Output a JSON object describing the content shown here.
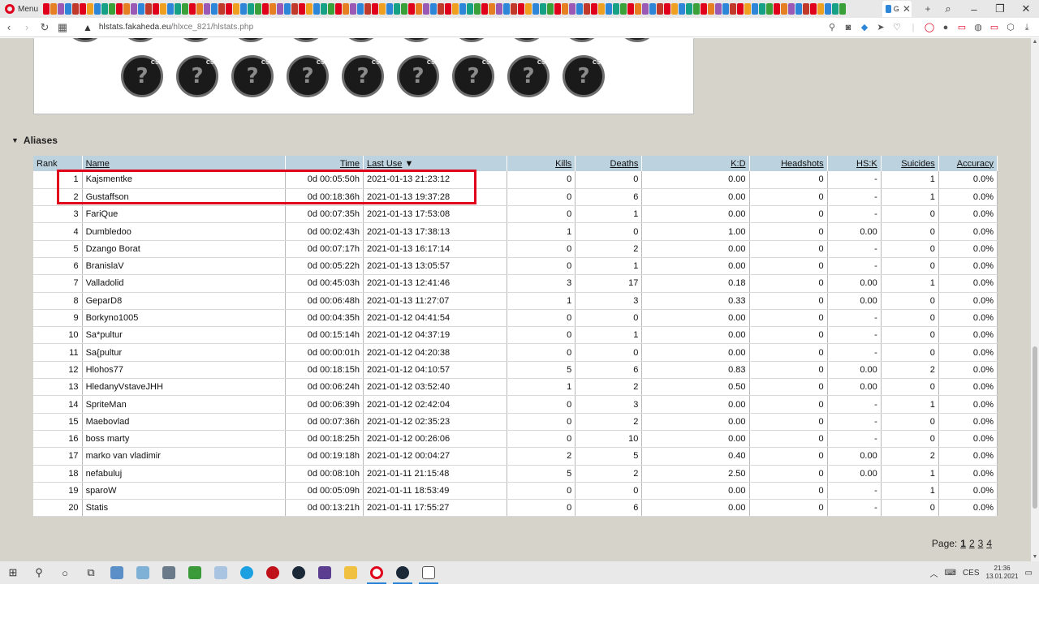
{
  "browser": {
    "menu_label": "Menu",
    "url_host": "hlstats.fakaheda.eu",
    "url_path": "/hlxce_821/hlstats.php",
    "active_tab_label": "G"
  },
  "aliases": {
    "section_title": "Aliases",
    "columns": [
      "Rank",
      "Name",
      "Time",
      "Last Use",
      "Kills",
      "Deaths",
      "K:D",
      "Headshots",
      "HS:K",
      "Suicides",
      "Accuracy"
    ],
    "sort_indicator": "▼",
    "rows": [
      [
        "1",
        "Kajsmentke",
        "0d 00:05:50h",
        "2021-01-13 21:23:12",
        "0",
        "0",
        "0.00",
        "0",
        "-",
        "1",
        "0.0%"
      ],
      [
        "2",
        "Gustaffson",
        "0d 00:18:36h",
        "2021-01-13 19:37:28",
        "0",
        "6",
        "0.00",
        "0",
        "-",
        "1",
        "0.0%"
      ],
      [
        "3",
        "FariQue",
        "0d 00:07:35h",
        "2021-01-13 17:53:08",
        "0",
        "1",
        "0.00",
        "0",
        "-",
        "0",
        "0.0%"
      ],
      [
        "4",
        "Dumbledoo",
        "0d 00:02:43h",
        "2021-01-13 17:38:13",
        "1",
        "0",
        "1.00",
        "0",
        "0.00",
        "0",
        "0.0%"
      ],
      [
        "5",
        "Dzango Borat",
        "0d 00:07:17h",
        "2021-01-13 16:17:14",
        "0",
        "2",
        "0.00",
        "0",
        "-",
        "0",
        "0.0%"
      ],
      [
        "6",
        "BranislaV",
        "0d 00:05:22h",
        "2021-01-13 13:05:57",
        "0",
        "1",
        "0.00",
        "0",
        "-",
        "0",
        "0.0%"
      ],
      [
        "7",
        "Valladolid",
        "0d 00:45:03h",
        "2021-01-13 12:41:46",
        "3",
        "17",
        "0.18",
        "0",
        "0.00",
        "1",
        "0.0%"
      ],
      [
        "8",
        "GeparD8",
        "0d 00:06:48h",
        "2021-01-13 11:27:07",
        "1",
        "3",
        "0.33",
        "0",
        "0.00",
        "0",
        "0.0%"
      ],
      [
        "9",
        "Borkyno1005",
        "0d 00:04:35h",
        "2021-01-12 04:41:54",
        "0",
        "0",
        "0.00",
        "0",
        "-",
        "0",
        "0.0%"
      ],
      [
        "10",
        "Sa*pultur",
        "0d 00:15:14h",
        "2021-01-12 04:37:19",
        "0",
        "1",
        "0.00",
        "0",
        "-",
        "0",
        "0.0%"
      ],
      [
        "11",
        "Sa{pultur",
        "0d 00:00:01h",
        "2021-01-12 04:20:38",
        "0",
        "0",
        "0.00",
        "0",
        "-",
        "0",
        "0.0%"
      ],
      [
        "12",
        "Hlohos77",
        "0d 00:18:15h",
        "2021-01-12 04:10:57",
        "5",
        "6",
        "0.83",
        "0",
        "0.00",
        "2",
        "0.0%"
      ],
      [
        "13",
        "HledanyVstaveJHH",
        "0d 00:06:24h",
        "2021-01-12 03:52:40",
        "1",
        "2",
        "0.50",
        "0",
        "0.00",
        "0",
        "0.0%"
      ],
      [
        "14",
        "SpriteMan",
        "0d 00:06:39h",
        "2021-01-12 02:42:04",
        "0",
        "3",
        "0.00",
        "0",
        "-",
        "1",
        "0.0%"
      ],
      [
        "15",
        "Maebovlad",
        "0d 00:07:36h",
        "2021-01-12 02:35:23",
        "0",
        "2",
        "0.00",
        "0",
        "-",
        "0",
        "0.0%"
      ],
      [
        "16",
        "boss marty",
        "0d 00:18:25h",
        "2021-01-12 00:26:06",
        "0",
        "10",
        "0.00",
        "0",
        "-",
        "0",
        "0.0%"
      ],
      [
        "17",
        "marko van vladimir",
        "0d 00:19:18h",
        "2021-01-12 00:04:27",
        "2",
        "5",
        "0.40",
        "0",
        "0.00",
        "2",
        "0.0%"
      ],
      [
        "18",
        "nefabuluj",
        "0d 00:08:10h",
        "2021-01-11 21:15:48",
        "5",
        "2",
        "2.50",
        "0",
        "0.00",
        "1",
        "0.0%"
      ],
      [
        "19",
        "sparoW",
        "0d 00:05:09h",
        "2021-01-11 18:53:49",
        "0",
        "0",
        "0.00",
        "0",
        "-",
        "1",
        "0.0%"
      ],
      [
        "20",
        "Statis",
        "0d 00:13:21h",
        "2021-01-11 17:55:27",
        "0",
        "6",
        "0.00",
        "0",
        "-",
        "0",
        "0.0%"
      ]
    ]
  },
  "award_icon_text": {
    "glyph": "?",
    "badge": "CS"
  },
  "pagination": {
    "label": "Page:",
    "current": "1",
    "pages": [
      "2",
      "3",
      "4"
    ]
  },
  "taskbar": {
    "time": "21:36",
    "date": "13.01.2021",
    "lang": "CES"
  },
  "colors": {
    "header_bg": "#bcd2de",
    "page_bg": "#d6d3ca",
    "highlight": "#e0001b"
  }
}
